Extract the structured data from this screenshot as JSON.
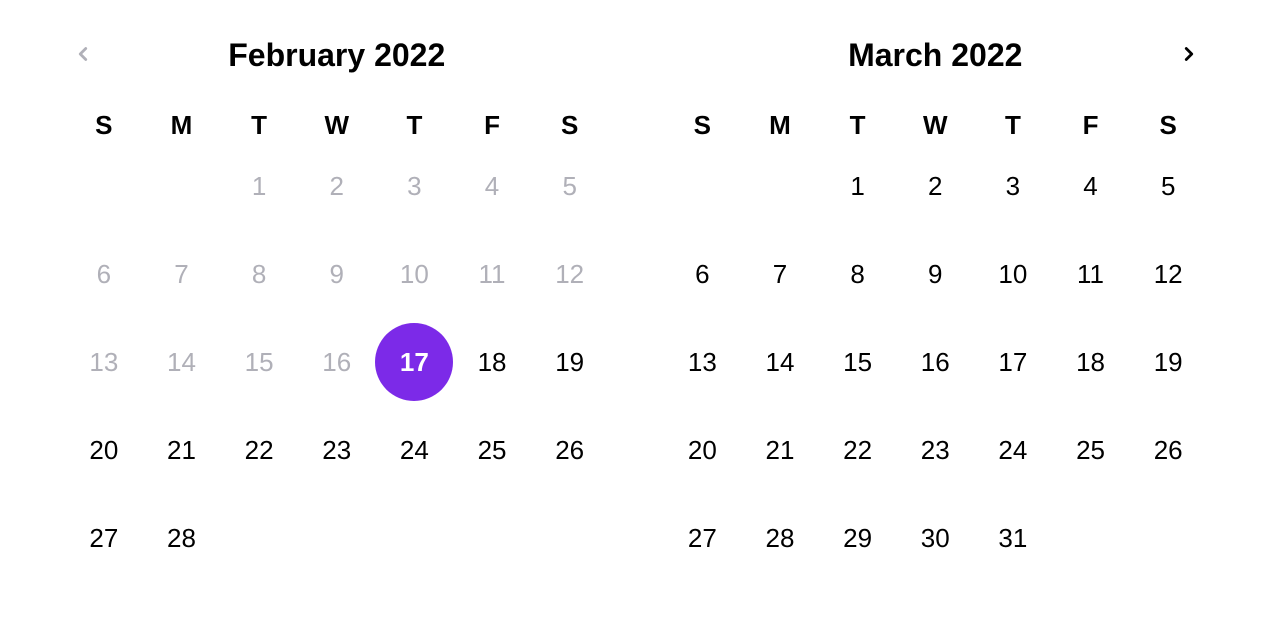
{
  "accent_color": "#7c2ae8",
  "weekdays": [
    "S",
    "M",
    "T",
    "W",
    "T",
    "F",
    "S"
  ],
  "months": [
    {
      "title": "February 2022",
      "show_prev": true,
      "show_next": false,
      "days": [
        {
          "n": "",
          "empty": true
        },
        {
          "n": "",
          "empty": true
        },
        {
          "n": "1",
          "disabled": true
        },
        {
          "n": "2",
          "disabled": true
        },
        {
          "n": "3",
          "disabled": true
        },
        {
          "n": "4",
          "disabled": true
        },
        {
          "n": "5",
          "disabled": true
        },
        {
          "n": "6",
          "disabled": true
        },
        {
          "n": "7",
          "disabled": true
        },
        {
          "n": "8",
          "disabled": true
        },
        {
          "n": "9",
          "disabled": true
        },
        {
          "n": "10",
          "disabled": true
        },
        {
          "n": "11",
          "disabled": true
        },
        {
          "n": "12",
          "disabled": true
        },
        {
          "n": "13",
          "disabled": true
        },
        {
          "n": "14",
          "disabled": true
        },
        {
          "n": "15",
          "disabled": true
        },
        {
          "n": "16",
          "disabled": true
        },
        {
          "n": "17",
          "selected": true
        },
        {
          "n": "18"
        },
        {
          "n": "19"
        },
        {
          "n": "20"
        },
        {
          "n": "21"
        },
        {
          "n": "22"
        },
        {
          "n": "23"
        },
        {
          "n": "24"
        },
        {
          "n": "25"
        },
        {
          "n": "26"
        },
        {
          "n": "27"
        },
        {
          "n": "28"
        }
      ]
    },
    {
      "title": "March 2022",
      "show_prev": false,
      "show_next": true,
      "days": [
        {
          "n": "",
          "empty": true
        },
        {
          "n": "",
          "empty": true
        },
        {
          "n": "1"
        },
        {
          "n": "2"
        },
        {
          "n": "3"
        },
        {
          "n": "4"
        },
        {
          "n": "5"
        },
        {
          "n": "6"
        },
        {
          "n": "7"
        },
        {
          "n": "8"
        },
        {
          "n": "9"
        },
        {
          "n": "10"
        },
        {
          "n": "11"
        },
        {
          "n": "12"
        },
        {
          "n": "13"
        },
        {
          "n": "14"
        },
        {
          "n": "15"
        },
        {
          "n": "16"
        },
        {
          "n": "17"
        },
        {
          "n": "18"
        },
        {
          "n": "19"
        },
        {
          "n": "20"
        },
        {
          "n": "21"
        },
        {
          "n": "22"
        },
        {
          "n": "23"
        },
        {
          "n": "24"
        },
        {
          "n": "25"
        },
        {
          "n": "26"
        },
        {
          "n": "27"
        },
        {
          "n": "28"
        },
        {
          "n": "29"
        },
        {
          "n": "30"
        },
        {
          "n": "31"
        }
      ]
    }
  ]
}
